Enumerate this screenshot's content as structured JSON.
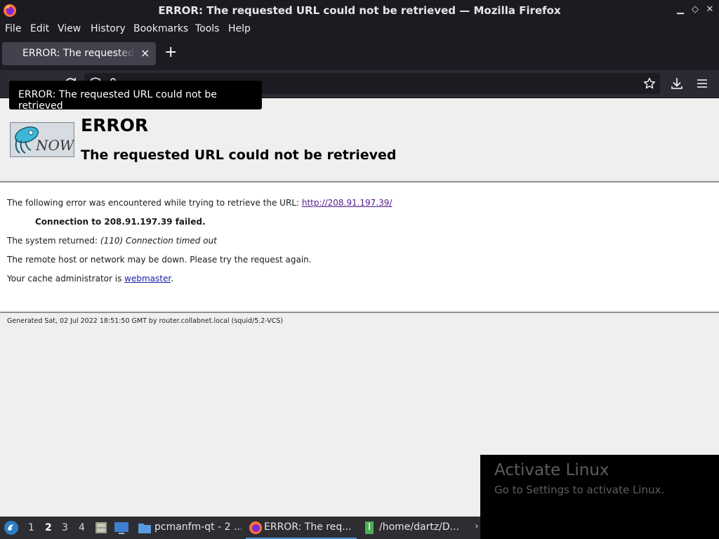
{
  "window": {
    "title": "ERROR: The requested URL could not be retrieved — Mozilla Firefox"
  },
  "menubar": {
    "items": [
      {
        "label": "File"
      },
      {
        "label": "Edit"
      },
      {
        "label": "View"
      },
      {
        "label": "History"
      },
      {
        "label": "Bookmarks"
      },
      {
        "label": "Tools"
      },
      {
        "label": "Help"
      }
    ]
  },
  "tabs": [
    {
      "label": "ERROR: The requested URL could not be retrieved",
      "close": "×"
    }
  ],
  "new_tab_label": "+",
  "tooltip": "ERROR: The requested URL could not be retrieved",
  "page": {
    "logo_text": "NOW",
    "heading": "ERROR",
    "subheading": "The requested URL could not be retrieved",
    "line1_prefix": "The following error was encountered while trying to retrieve the URL: ",
    "line1_link": "http://208.91.197.39/",
    "line2": "Connection to 208.91.197.39 failed.",
    "line3_prefix": "The system returned: ",
    "line3_em": "(110) Connection timed out",
    "line4": "The remote host or network may be down. Please try the request again.",
    "line5_prefix": "Your cache administrator is ",
    "line5_link": "webmaster",
    "line5_suffix": ".",
    "footer": "Generated Sat, 02 Jul 2022 18:51:50 GMT by router.collabnet.local (squid/5.2-VCS)"
  },
  "activate": {
    "title": "Activate Linux",
    "subtitle": "Go to Settings to activate Linux."
  },
  "taskbar": {
    "workspaces": [
      "1",
      "2",
      "3",
      "4"
    ],
    "active_workspace": "2",
    "tasks": [
      {
        "label": "pcmanfm-qt - 2 ..."
      },
      {
        "label": "ERROR: The req..."
      },
      {
        "label": "/home/dartz/D..."
      }
    ]
  },
  "colors": {
    "chrome_dark": "#1c1b22",
    "toolbar": "#2b2a33",
    "tab_selected": "#42414d",
    "link": "#2020a0",
    "visited_link": "#551a8b"
  }
}
